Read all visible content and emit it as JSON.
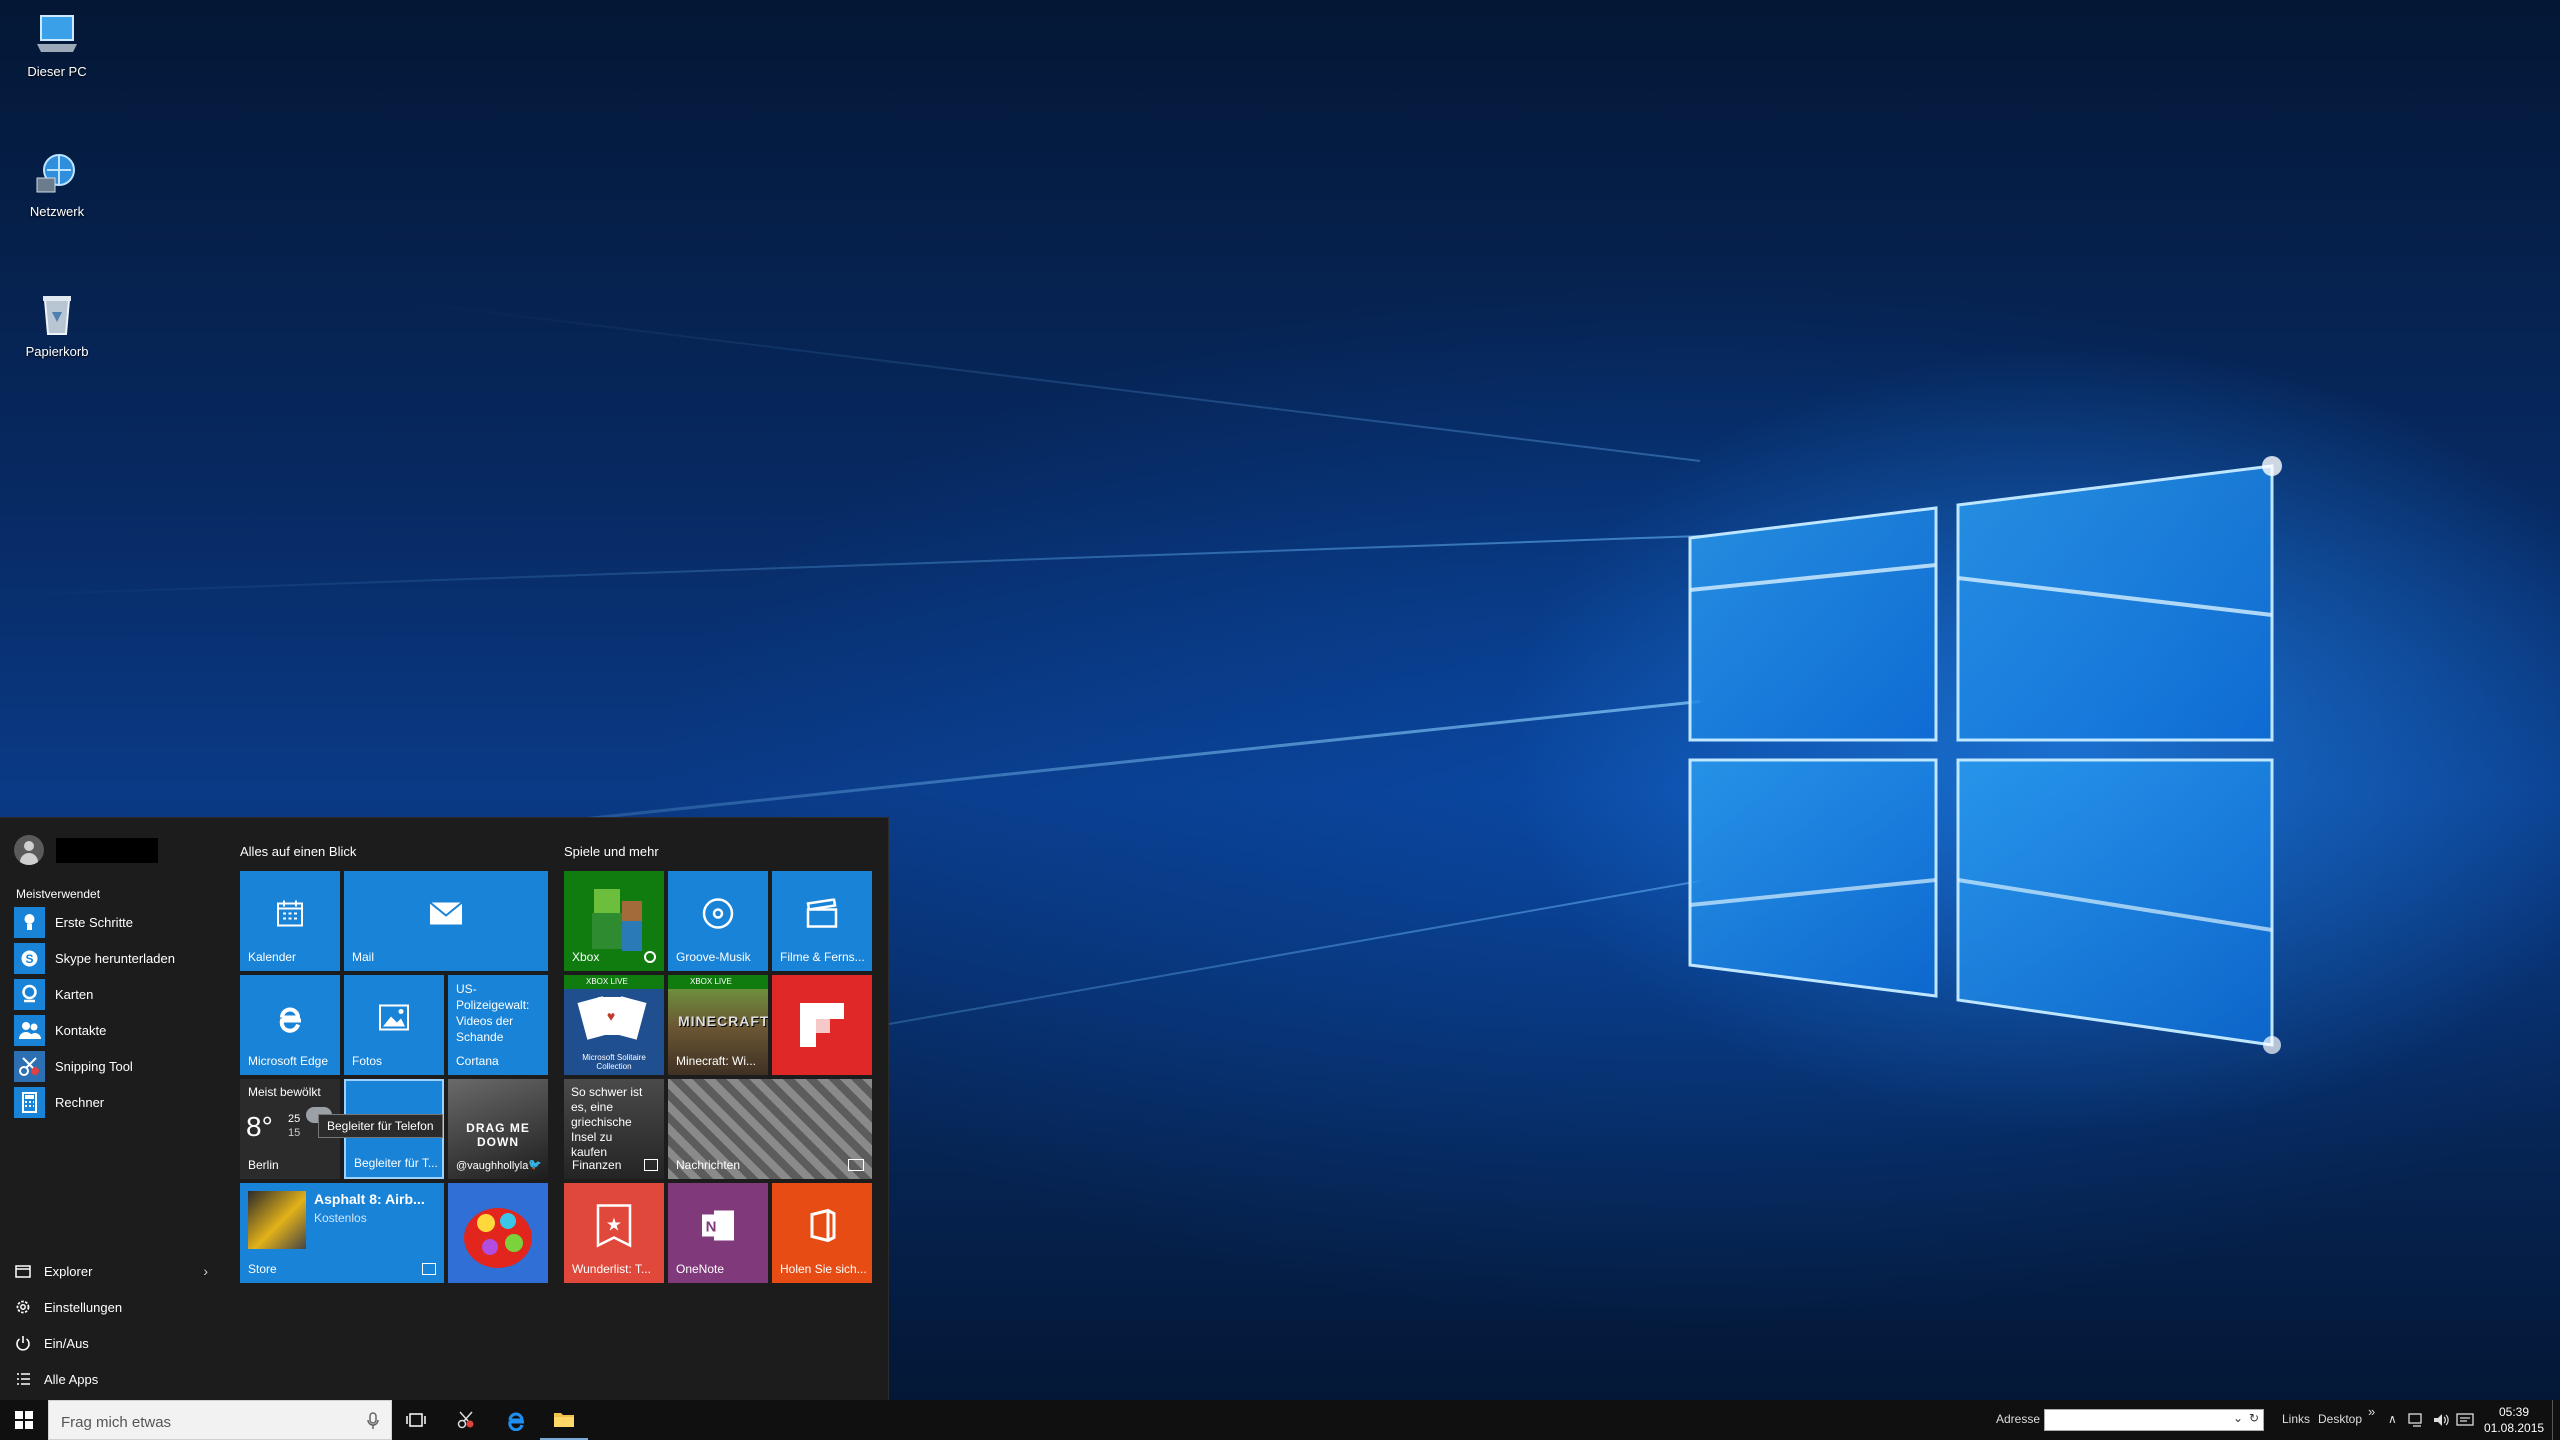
{
  "desktop_icons": [
    {
      "label": "Dieser PC",
      "icon": "computer-icon"
    },
    {
      "label": "Netzwerk",
      "icon": "network-globe-icon"
    },
    {
      "label": "Papierkorb",
      "icon": "recycle-bin-icon"
    }
  ],
  "start_menu": {
    "most_used_heading": "Meistverwendet",
    "most_used": [
      {
        "label": "Erste Schritte",
        "icon": "lightbulb-icon"
      },
      {
        "label": "Skype herunterladen",
        "icon": "skype-icon"
      },
      {
        "label": "Karten",
        "icon": "maps-icon"
      },
      {
        "label": "Kontakte",
        "icon": "people-icon"
      },
      {
        "label": "Snipping Tool",
        "icon": "scissors-icon"
      },
      {
        "label": "Rechner",
        "icon": "calculator-icon"
      }
    ],
    "bottom": [
      {
        "label": "Explorer",
        "icon": "folder-icon",
        "chevron": "›"
      },
      {
        "label": "Einstellungen",
        "icon": "gear-icon"
      },
      {
        "label": "Ein/Aus",
        "icon": "power-icon"
      },
      {
        "label": "Alle Apps",
        "icon": "list-icon"
      }
    ],
    "group1_title": "Alles auf einen Blick",
    "group2_title": "Spiele und mehr",
    "tiles": {
      "kalender": "Kalender",
      "mail": "Mail",
      "edge": "Microsoft Edge",
      "fotos": "Fotos",
      "cortana_news": "US-Polizeigewalt: Videos der Schande",
      "cortana": "Cortana",
      "weather_status": "Meist bewölkt",
      "weather_temp": "8°",
      "weather_hi": "25",
      "weather_lo": "15",
      "weather_city": "Berlin",
      "phone": "Begleiter für T...",
      "phone_tooltip": "Begleiter für Telefon",
      "twitter_text": "DRAG ME DOWN",
      "twitter_user": "@vaughhollyla",
      "store_app": "Asphalt 8: Airb...",
      "store_price": "Kostenlos",
      "store": "Store",
      "xbox": "Xbox",
      "groove": "Groove-Musik",
      "filme": "Filme & Ferns...",
      "xbox_live": "XBOX LIVE",
      "solitaire": "Microsoft Solitaire Collection",
      "minecraft": "Minecraft: Wi...",
      "finanzen_news": "So schwer ist es, eine griechische Insel zu kaufen",
      "finanzen": "Finanzen",
      "nachrichten": "Nachrichten",
      "wunderlist": "Wunderlist: T...",
      "onenote": "OneNote",
      "office": "Holen Sie sich..."
    }
  },
  "taskbar": {
    "search_placeholder": "Frag mich etwas",
    "address_label": "Adresse",
    "address_value": "",
    "links_label": "Links",
    "desktop_label": "Desktop",
    "overflow": "»",
    "time": "05:39",
    "date": "01.08.2015"
  },
  "colors": {
    "tile_blue": "#1883d7",
    "xbox_green": "#107c10",
    "flipboard_red": "#e12828",
    "wunderlist_red": "#e0483b",
    "onenote_purple": "#80397b",
    "office_orange": "#e84c15",
    "start_bg": "#1c1c1c",
    "taskbar_bg": "#101010"
  }
}
